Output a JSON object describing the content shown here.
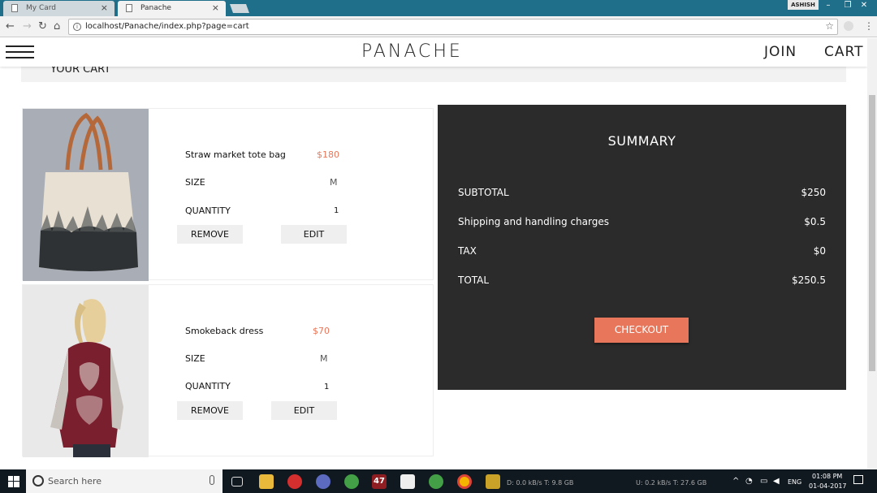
{
  "browser": {
    "tabs": [
      {
        "label": "My Card",
        "active": false
      },
      {
        "label": "Panache",
        "active": true
      }
    ],
    "user": "ASHISH",
    "url": "localhost/Panache/index.php?page=cart"
  },
  "site": {
    "logo": "PANACHE",
    "nav": {
      "join": "JOIN",
      "cart": "CART"
    },
    "cart_heading": "YOUR CART"
  },
  "cart_items": [
    {
      "name": "Straw market tote bag",
      "price": "$180",
      "size_label": "SIZE",
      "size": "M",
      "quantity_label": "QUANTITY",
      "quantity": "1",
      "remove_label": "REMOVE",
      "edit_label": "EDIT"
    },
    {
      "name": "Smokeback dress",
      "price": "$70",
      "size_label": "SIZE",
      "size": "M",
      "quantity_label": "QUANTITY",
      "quantity": "1",
      "remove_label": "REMOVE",
      "edit_label": "EDIT"
    }
  ],
  "summary": {
    "title": "SUMMARY",
    "rows": [
      {
        "label": "SUBTOTAL",
        "value": "$250"
      },
      {
        "label": "Shipping and handling charges",
        "value": "$0.5"
      },
      {
        "label": "TAX",
        "value": "$0"
      },
      {
        "label": "TOTAL",
        "value": "$250.5"
      }
    ],
    "checkout_label": "CHECKOUT"
  },
  "taskbar": {
    "search_placeholder": "Search here",
    "badge_count": "47",
    "net_stat_1": "D: 0.0 kB/s T: 9.8 GB",
    "net_stat_2": "U: 0.2 kB/s T: 27.6 GB",
    "language": "ENG",
    "time": "01:08 PM",
    "date": "01-04-2017"
  },
  "colors": {
    "accent": "#e8765a",
    "summary_bg": "#2b2b2b",
    "titlebar": "#1f6f8b"
  }
}
